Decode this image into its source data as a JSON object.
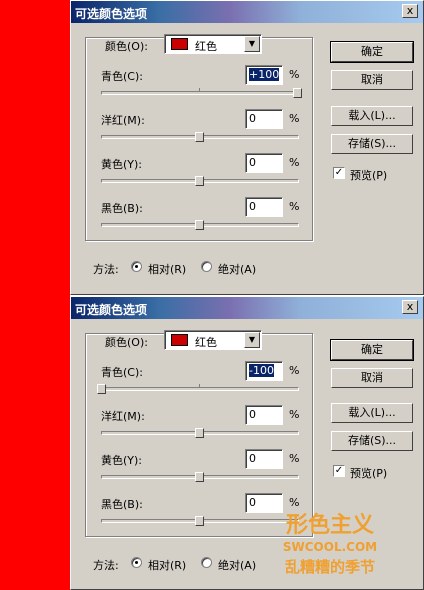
{
  "dialogs": [
    {
      "title": "可选颜色选项",
      "close_glyph": "x",
      "colors_label": "颜色(O):",
      "color_value": "红色",
      "sliders": [
        {
          "label": "青色(C):",
          "value": "+100",
          "value_pct": 100
        },
        {
          "label": "洋红(M):",
          "value": "0",
          "value_pct": 50
        },
        {
          "label": "黄色(Y):",
          "value": "0",
          "value_pct": 50
        },
        {
          "label": "黑色(B):",
          "value": "0",
          "value_pct": 50
        }
      ],
      "percent_sign": "%",
      "buttons": {
        "ok": "确定",
        "cancel": "取消",
        "load": "载入(L)...",
        "save": "存储(S)..."
      },
      "preview_label": "预览(P)",
      "preview_checked": true,
      "method_label": "方法:",
      "relative_label": "相对(R)",
      "absolute_label": "绝对(A)",
      "method_selected": "relative"
    },
    {
      "title": "可选颜色选项",
      "close_glyph": "x",
      "colors_label": "颜色(O):",
      "color_value": "红色",
      "sliders": [
        {
          "label": "青色(C):",
          "value": "-100",
          "value_pct": 0
        },
        {
          "label": "洋红(M):",
          "value": "0",
          "value_pct": 50
        },
        {
          "label": "黄色(Y):",
          "value": "0",
          "value_pct": 50
        },
        {
          "label": "黑色(B):",
          "value": "0",
          "value_pct": 50
        }
      ],
      "percent_sign": "%",
      "buttons": {
        "ok": "确定",
        "cancel": "取消",
        "load": "载入(L)...",
        "save": "存储(S)..."
      },
      "preview_label": "预览(P)",
      "preview_checked": true,
      "method_label": "方法:",
      "relative_label": "相对(R)",
      "absolute_label": "绝对(A)",
      "method_selected": "relative"
    }
  ],
  "watermark": {
    "brand": "形色主义",
    "site": "SWCOOL.COM",
    "tagline": "乱糟糟的季节"
  },
  "colors": {
    "red_strip": "#ff0000",
    "swatch": "#cc0000",
    "watermark": "#f0a030",
    "selection": "#0a246a"
  }
}
